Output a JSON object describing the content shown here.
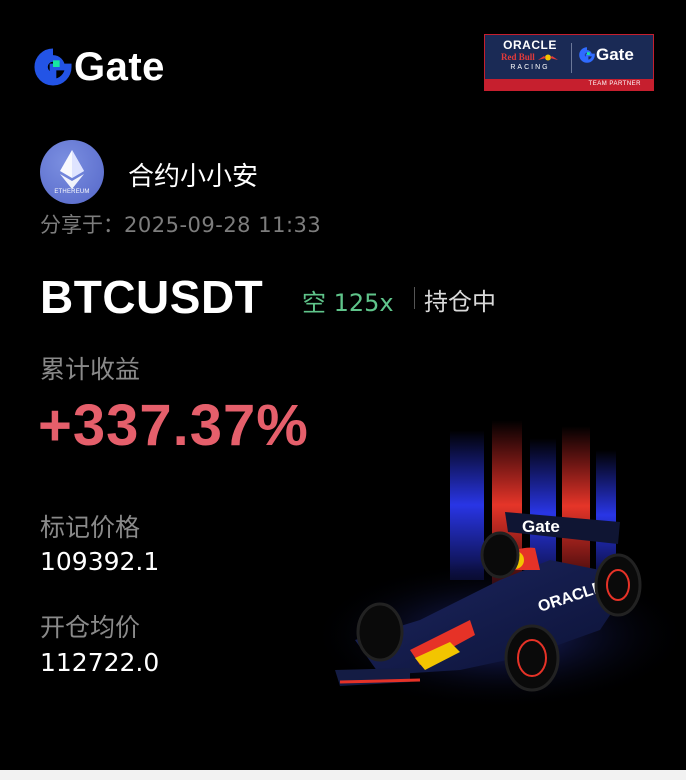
{
  "header": {
    "brand": "Gate",
    "partner": {
      "oracle": "ORACLE",
      "redbull": "Red Bull",
      "racing": "RACING",
      "gate": "Gate",
      "footer": "TEAM PARTNER"
    }
  },
  "user": {
    "avatar_label": "ETHEREUM",
    "name": "合约小小安",
    "shared_label": "分享于：",
    "shared_time": "2025-09-28 11:33"
  },
  "position": {
    "symbol": "BTCUSDT",
    "direction": "空 125x",
    "status": "持仓中"
  },
  "pnl": {
    "label": "累计收益",
    "value": "+337.37%"
  },
  "mark_price": {
    "label": "标记价格",
    "value": "109392.1"
  },
  "entry_price": {
    "label": "开仓均价",
    "value": "112722.0"
  },
  "car": {
    "nose_brand": "Gate",
    "sidepod_brand": "ORACLE"
  },
  "colors": {
    "background": "#000000",
    "profit": "#e55f6b",
    "short": "#5fc48a",
    "muted": "#8a8a8a",
    "brand_blue": "#2354e6",
    "brand_green": "#17e6a1"
  }
}
